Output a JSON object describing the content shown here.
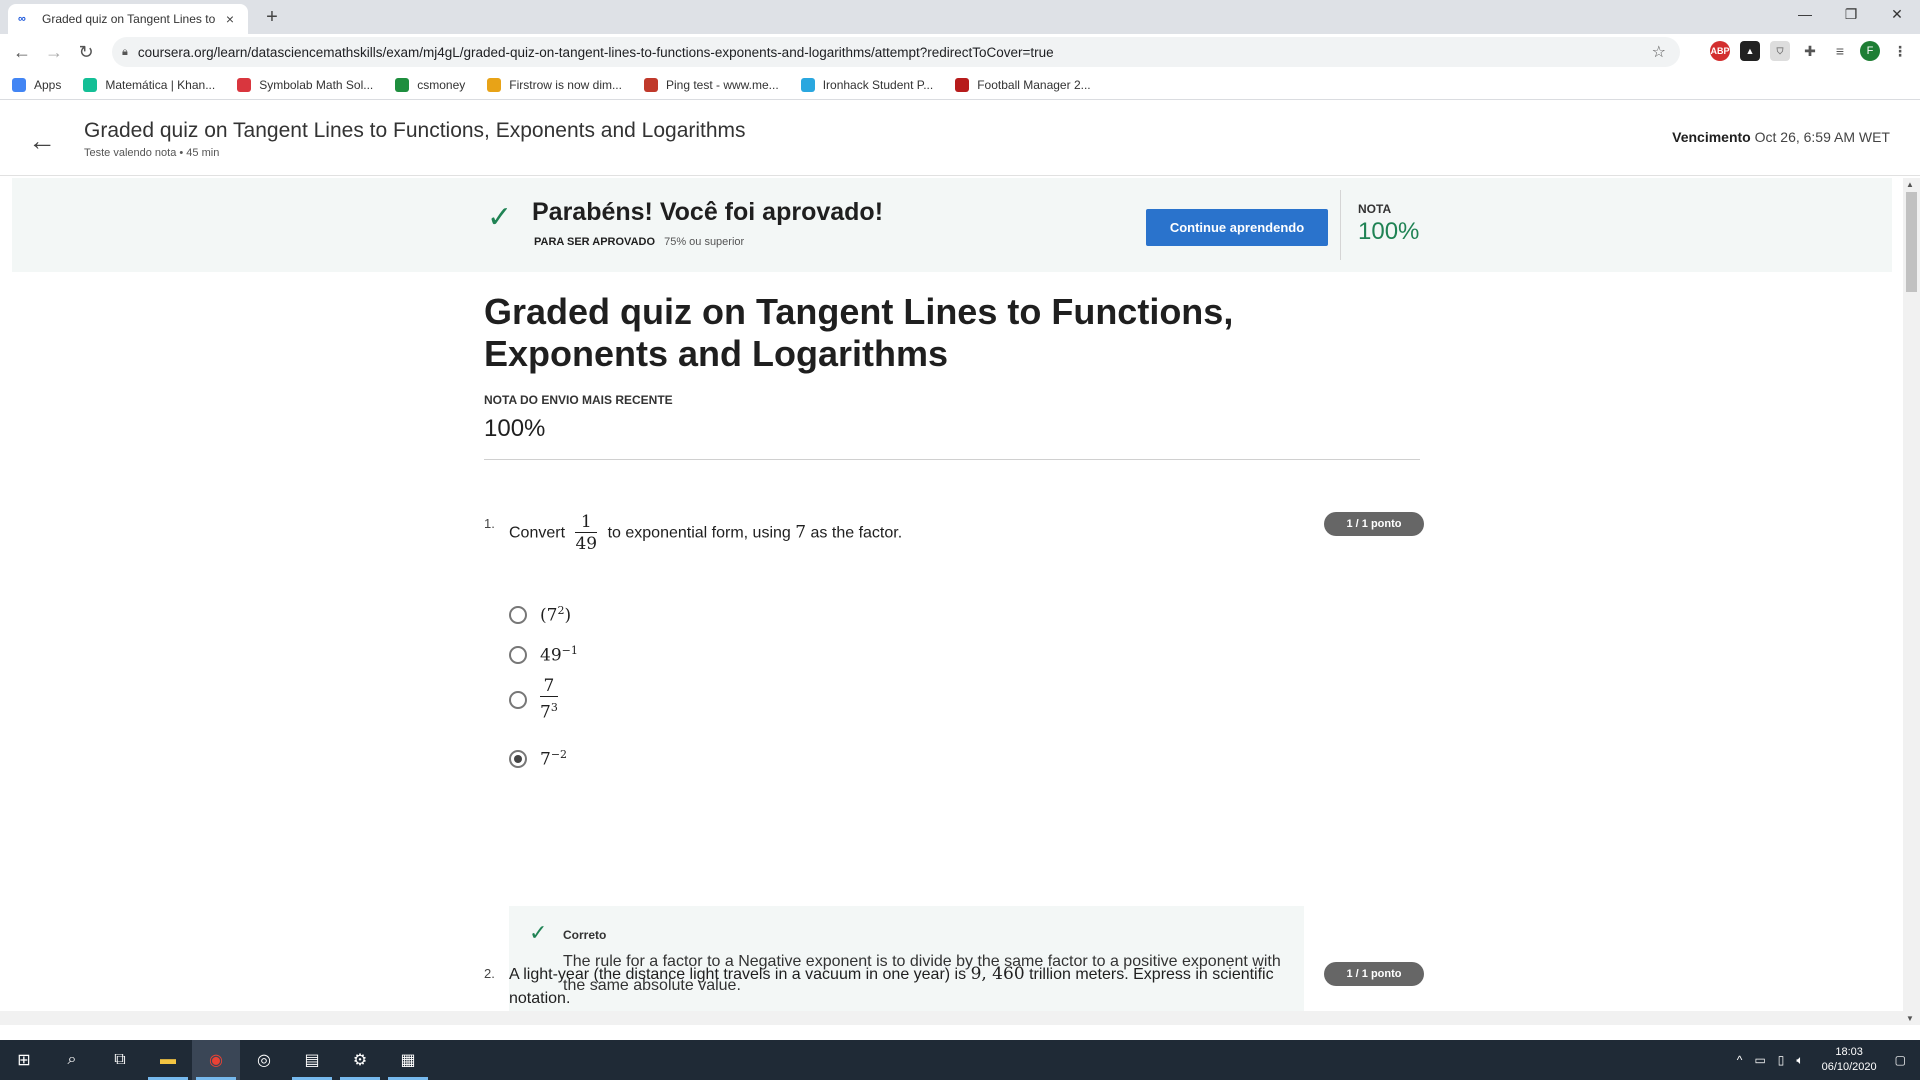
{
  "browser": {
    "tab_title": "Graded quiz on Tangent Lines to",
    "tab_close": "×",
    "new_tab": "+",
    "url": "coursera.org/learn/datasciencemathskills/exam/mj4gL/graded-quiz-on-tangent-lines-to-functions-exponents-and-logarithms/attempt?redirectToCover=true",
    "bookmarks": [
      {
        "label": "Apps",
        "color": "#4285f4"
      },
      {
        "label": "Matemática | Khan...",
        "color": "#14bf96"
      },
      {
        "label": "Symbolab Math Sol...",
        "color": "#d9363e"
      },
      {
        "label": "csmoney",
        "color": "#1e8e3e"
      },
      {
        "label": "Firstrow is now dim...",
        "color": "#e8a317"
      },
      {
        "label": "Ping test - www.me...",
        "color": "#c0392b"
      },
      {
        "label": "Ironhack Student P...",
        "color": "#2aa7df"
      },
      {
        "label": "Football Manager 2...",
        "color": "#b71c1c"
      }
    ],
    "profile_initial": "F",
    "ext_abp": "ABP"
  },
  "header": {
    "title": "Graded quiz on Tangent Lines to Functions, Exponents and Logarithms",
    "subtitle": "Teste valendo nota • 45 min",
    "due_label": "Vencimento",
    "due_value": "Oct 26, 6:59 AM WET"
  },
  "banner": {
    "message": "Parabéns! Você foi aprovado!",
    "req_label": "PARA SER APROVADO",
    "req_value": "75% ou superior",
    "continue_label": "Continue aprendendo",
    "grade_label": "NOTA",
    "grade_value": "100%"
  },
  "main": {
    "title": "Graded quiz on Tangent Lines to Functions, Exponents and Logarithms",
    "recent_label": "NOTA DO ENVIO MAIS RECENTE",
    "recent_value": "100%"
  },
  "q1": {
    "number": "1.",
    "text_a": "Convert",
    "frac_num": "1",
    "frac_den": "49",
    "text_b": "to exponential form, using",
    "factor": "7",
    "text_c": "as the factor.",
    "points": "1 / 1 ponto",
    "options": {
      "o1_base": "(7",
      "o1_exp": "2",
      "o1_close": ")",
      "o2_base": "49",
      "o2_exp": "−1",
      "o3_num": "7",
      "o3_den_base": "7",
      "o3_den_exp": "3",
      "o4_base": "7",
      "o4_exp": "−2"
    },
    "selected_option": 4,
    "feedback_label": "Correto",
    "feedback_text": "The rule for a factor to a Negative exponent is to divide by the same factor to a positive exponent with the same absolute value."
  },
  "q2": {
    "number": "2.",
    "text_a": "A light-year (the distance light travels in a vacuum in one year) is",
    "value": "9, 460",
    "text_b": "trillion meters. Express in scientific notation.",
    "points": "1 / 1 ponto"
  },
  "taskbar": {
    "time": "18:03",
    "date": "06/10/2020"
  }
}
